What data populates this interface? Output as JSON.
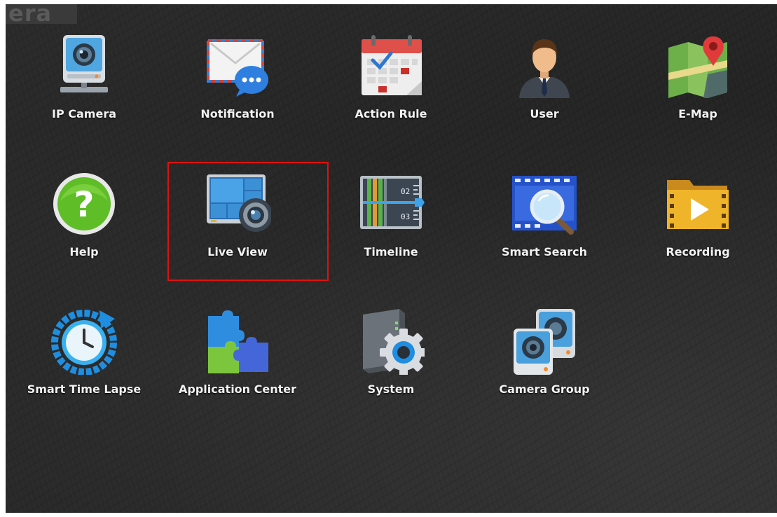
{
  "brand": {
    "text": "era"
  },
  "apps": [
    {
      "label": "IP Camera",
      "icon": "ip-camera-icon"
    },
    {
      "label": "Notification",
      "icon": "notification-icon"
    },
    {
      "label": "Action Rule",
      "icon": "calendar-icon"
    },
    {
      "label": "User",
      "icon": "user-icon"
    },
    {
      "label": "E-Map",
      "icon": "map-icon"
    },
    {
      "label": "Help",
      "icon": "help-icon"
    },
    {
      "label": "Live View",
      "icon": "live-view-icon",
      "selected": true
    },
    {
      "label": "Timeline",
      "icon": "timeline-icon",
      "marks": [
        "02",
        "03"
      ]
    },
    {
      "label": "Smart Search",
      "icon": "search-icon"
    },
    {
      "label": "Recording",
      "icon": "recording-icon"
    },
    {
      "label": "Smart Time Lapse",
      "icon": "time-lapse-icon"
    },
    {
      "label": "Application Center",
      "icon": "puzzle-icon"
    },
    {
      "label": "System",
      "icon": "system-gear-icon"
    },
    {
      "label": "Camera Group",
      "icon": "camera-group-icon"
    }
  ],
  "colors": {
    "highlight": "#e01010",
    "background": "#262626"
  }
}
